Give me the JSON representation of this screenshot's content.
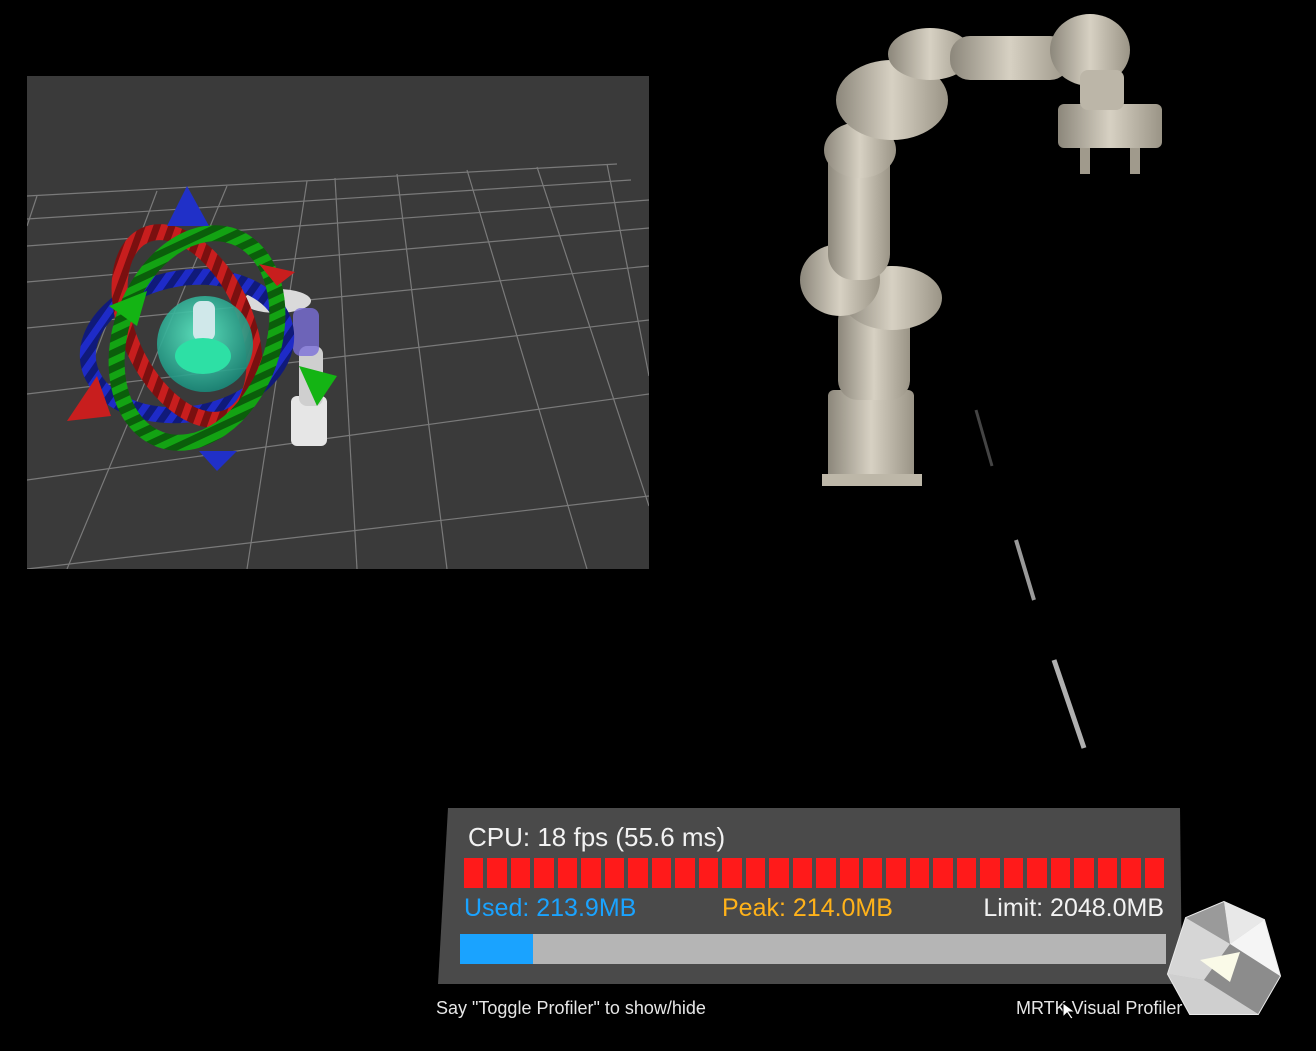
{
  "profiler": {
    "cpu_label": "CPU: 18 fps (55.6 ms)",
    "used_label": "Used: 213.9MB",
    "peak_label": "Peak: 214.0MB",
    "limit_label": "Limit: 2048.0MB",
    "memory_used_fraction": 0.104,
    "frame_segments": 30,
    "colors": {
      "frame_over_budget": "#ff1a1a",
      "used": "#1aa3ff",
      "peak": "#ffb21a",
      "limit": "#f2f2f2",
      "bar_bg": "#b5b5b5"
    }
  },
  "hint_text": "Say \"Toggle Profiler\" to show/hide",
  "profiler_title": "MRTK Visual Profiler",
  "icons": {
    "logo": "mrtk-logo-icon",
    "cursor": "pointer-cursor-icon"
  }
}
